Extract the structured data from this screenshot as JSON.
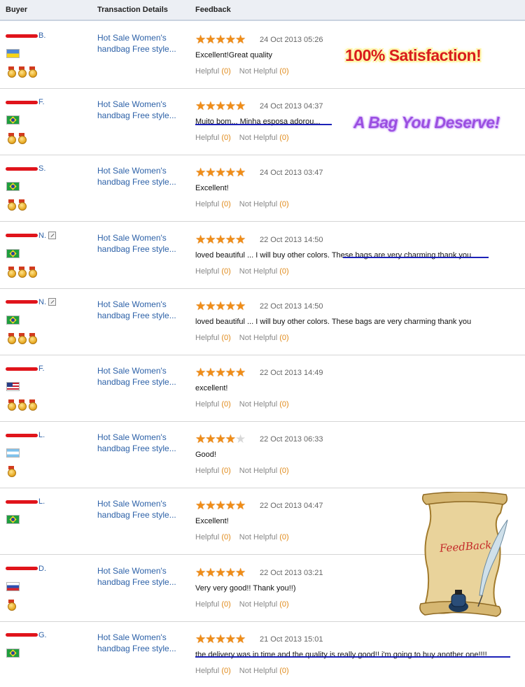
{
  "header": {
    "buyer": "Buyer",
    "transaction": "Transaction Details",
    "feedback": "Feedback"
  },
  "rows": [
    {
      "name_suffix": "B.",
      "flag": "ukraine-flag",
      "medals": 3,
      "edit_icon": false,
      "transaction": "Hot Sale Women's handbag Free style...",
      "stars": 5,
      "date": "24 Oct 2013 05:26",
      "comment": "Excellent!Great quality",
      "helpful_label": "Helpful",
      "helpful_count": "(0)",
      "not_helpful_label": "Not Helpful",
      "not_helpful_count": "(0)"
    },
    {
      "name_suffix": "F.",
      "flag": "brazil-flag",
      "medals": 2,
      "edit_icon": false,
      "transaction": "Hot Sale Women's handbag Free style...",
      "stars": 5,
      "date": "24 Oct 2013 04:37",
      "comment": "Muito bom... Minha esposa adorou...",
      "helpful_label": "Helpful",
      "helpful_count": "(0)",
      "not_helpful_label": "Not Helpful",
      "not_helpful_count": "(0)"
    },
    {
      "name_suffix": "S.",
      "flag": "brazil-flag",
      "medals": 2,
      "edit_icon": false,
      "transaction": "Hot Sale Women's handbag Free style...",
      "stars": 5,
      "date": "24 Oct 2013 03:47",
      "comment": "Excellent!",
      "helpful_label": "Helpful",
      "helpful_count": "(0)",
      "not_helpful_label": "Not Helpful",
      "not_helpful_count": "(0)"
    },
    {
      "name_suffix": "N.",
      "flag": "brazil-flag",
      "medals": 3,
      "edit_icon": true,
      "transaction": "Hot Sale Women's handbag Free style...",
      "stars": 5,
      "date": "22 Oct 2013 14:50",
      "comment": "loved beautiful ... I will buy other colors. These bags are very charming thank you",
      "helpful_label": "Helpful",
      "helpful_count": "(0)",
      "not_helpful_label": "Not Helpful",
      "not_helpful_count": "(0)"
    },
    {
      "name_suffix": "N.",
      "flag": "brazil-flag",
      "medals": 3,
      "edit_icon": true,
      "transaction": "Hot Sale Women's handbag Free style...",
      "stars": 5,
      "date": "22 Oct 2013 14:50",
      "comment": "loved beautiful ... I will buy other colors. These bags are very charming thank you",
      "helpful_label": "Helpful",
      "helpful_count": "(0)",
      "not_helpful_label": "Not Helpful",
      "not_helpful_count": "(0)"
    },
    {
      "name_suffix": "F.",
      "flag": "usa-flag",
      "medals": 3,
      "edit_icon": false,
      "transaction": "Hot Sale Women's handbag Free style...",
      "stars": 5,
      "date": "22 Oct 2013 14:49",
      "comment": "excellent!",
      "helpful_label": "Helpful",
      "helpful_count": "(0)",
      "not_helpful_label": "Not Helpful",
      "not_helpful_count": "(0)"
    },
    {
      "name_suffix": "L.",
      "flag": "argentina-flag",
      "medals": 1,
      "edit_icon": false,
      "transaction": "Hot Sale Women's handbag Free style...",
      "stars": 4,
      "date": "22 Oct 2013 06:33",
      "comment": "Good!",
      "helpful_label": "Helpful",
      "helpful_count": "(0)",
      "not_helpful_label": "Not Helpful",
      "not_helpful_count": "(0)"
    },
    {
      "name_suffix": "L.",
      "flag": "brazil-flag",
      "medals": 0,
      "edit_icon": false,
      "transaction": "Hot Sale Women's handbag Free style...",
      "stars": 5,
      "date": "22 Oct 2013 04:47",
      "comment": "Excellent!",
      "helpful_label": "Helpful",
      "helpful_count": "(0)",
      "not_helpful_label": "Not Helpful",
      "not_helpful_count": "(0)"
    },
    {
      "name_suffix": "D.",
      "flag": "russia-flag",
      "medals": 1,
      "edit_icon": false,
      "transaction": "Hot Sale Women's handbag Free style...",
      "stars": 5,
      "date": "22 Oct 2013 03:21",
      "comment": "Very very good!! Thank you!!)",
      "helpful_label": "Helpful",
      "helpful_count": "(0)",
      "not_helpful_label": "Not Helpful",
      "not_helpful_count": "(0)"
    },
    {
      "name_suffix": "G.",
      "flag": "brazil-flag",
      "medals": 0,
      "edit_icon": false,
      "transaction": "Hot Sale Women's handbag Free style...",
      "stars": 5,
      "date": "21 Oct 2013 15:01",
      "comment": "the delivery was in time and the quality is really good!! i'm going to buy another one!!!!",
      "helpful_label": "Helpful",
      "helpful_count": "(0)",
      "not_helpful_label": "Not Helpful",
      "not_helpful_count": "(0)"
    }
  ],
  "overlays": {
    "promo_satisfaction": "100% Satisfaction!",
    "promo_deserve": "A Bag You Deserve!",
    "scroll_label": "FeedBack"
  },
  "colors": {
    "link_blue": "#2e62a8",
    "star_orange": "#f08d18",
    "count_orange": "#e08a1a",
    "redaction_red": "#e0141b"
  }
}
